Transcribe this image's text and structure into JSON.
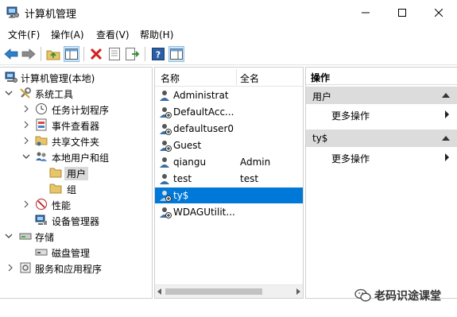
{
  "window": {
    "title": "计算机管理"
  },
  "menu": {
    "items": [
      "文件(F)",
      "操作(A)",
      "查看(V)",
      "帮助(H)"
    ]
  },
  "toolbar": {
    "icons": [
      "back-icon",
      "forward-icon",
      "up-folder-icon",
      "show-hide-tree-icon",
      "delete-icon",
      "properties-icon",
      "export-icon",
      "help-icon",
      "action-pane-icon"
    ]
  },
  "tree": {
    "items": [
      {
        "label": "计算机管理(本地)"
      },
      {
        "label": "系统工具"
      },
      {
        "label": "任务计划程序"
      },
      {
        "label": "事件查看器"
      },
      {
        "label": "共享文件夹"
      },
      {
        "label": "本地用户和组"
      },
      {
        "label": "用户"
      },
      {
        "label": "组"
      },
      {
        "label": "性能"
      },
      {
        "label": "设备管理器"
      },
      {
        "label": "存储"
      },
      {
        "label": "磁盘管理"
      },
      {
        "label": "服务和应用程序"
      }
    ]
  },
  "list": {
    "columns": {
      "name": "名称",
      "fullname": "全名"
    },
    "rows": [
      {
        "name": "Administrat",
        "fullname": ""
      },
      {
        "name": "DefaultAcc...",
        "fullname": ""
      },
      {
        "name": "defaultuser0",
        "fullname": ""
      },
      {
        "name": "Guest",
        "fullname": ""
      },
      {
        "name": "qiangu",
        "fullname": "Admin"
      },
      {
        "name": "test",
        "fullname": "test"
      },
      {
        "name": "ty$",
        "fullname": ""
      },
      {
        "name": "WDAGUtilit...",
        "fullname": ""
      }
    ]
  },
  "actions": {
    "title": "操作",
    "sections": [
      {
        "label": "用户",
        "link": "更多操作"
      },
      {
        "label": "ty$",
        "link": "更多操作"
      }
    ]
  },
  "watermark": {
    "text": "老码识途课堂"
  },
  "colors": {
    "selection": "#0078d7",
    "section_bg": "#dcdcdc",
    "folder": "#e8c46a"
  }
}
